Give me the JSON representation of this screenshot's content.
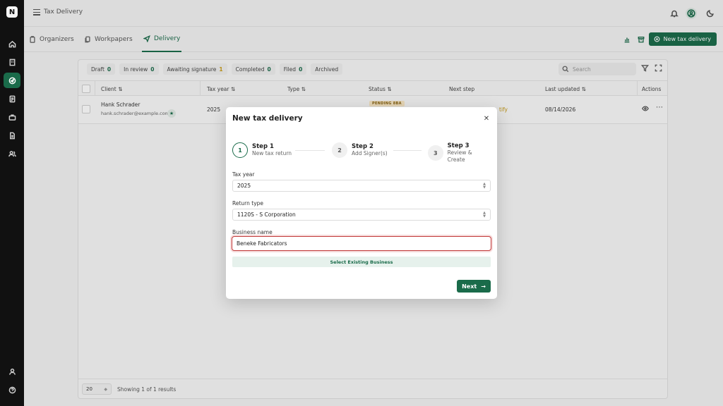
{
  "header": {
    "title": "Tax Delivery"
  },
  "tabs": [
    {
      "label": "Organizers",
      "icon": "clipboard-icon"
    },
    {
      "label": "Workpapers",
      "icon": "files-icon"
    },
    {
      "label": "Delivery",
      "icon": "send-icon",
      "active": true
    }
  ],
  "toolbar": {
    "new_delivery_label": "New tax delivery"
  },
  "filters": [
    {
      "label": "Draft",
      "count": "0"
    },
    {
      "label": "In review",
      "count": "0"
    },
    {
      "label": "Awaiting signature",
      "count": "1"
    },
    {
      "label": "Completed",
      "count": "0"
    },
    {
      "label": "Filed",
      "count": "0"
    },
    {
      "label": "Archived",
      "count": ""
    }
  ],
  "search": {
    "placeholder": "Search"
  },
  "table": {
    "columns": [
      "Client ⇅",
      "Tax year ⇅",
      "Type ⇅",
      "Status ⇅",
      "Next step",
      "Last updated ⇅",
      "Actions"
    ],
    "rows": [
      {
        "client_name": "Hank Schrader",
        "client_email": "hank.schrader@example.com",
        "tax_year": "2025",
        "status": "PENDING 8BA",
        "next_step": "tify",
        "last_updated": "08/14/2026"
      }
    ]
  },
  "pagination": {
    "page_size": "20",
    "showing": "Showing 1 of 1 results"
  },
  "modal": {
    "title": "New tax delivery",
    "steps": [
      {
        "num": "1",
        "title": "Step 1",
        "subtitle": "New tax return"
      },
      {
        "num": "2",
        "title": "Step 2",
        "subtitle": "Add Signer(s)"
      },
      {
        "num": "3",
        "title": "Step 3",
        "subtitle": "Review & Create"
      }
    ],
    "tax_year_label": "Tax year",
    "tax_year_value": "2025",
    "return_type_label": "Return type",
    "return_type_value": "1120S - S Corporation",
    "business_name_label": "Business name",
    "business_name_value": "Beneke Fabricators",
    "select_existing_label": "Select Existing Business",
    "next_label": "Next"
  },
  "colors": {
    "brand": "#1a6b4a",
    "error": "#c23b3b",
    "warning": "#c79a16"
  }
}
